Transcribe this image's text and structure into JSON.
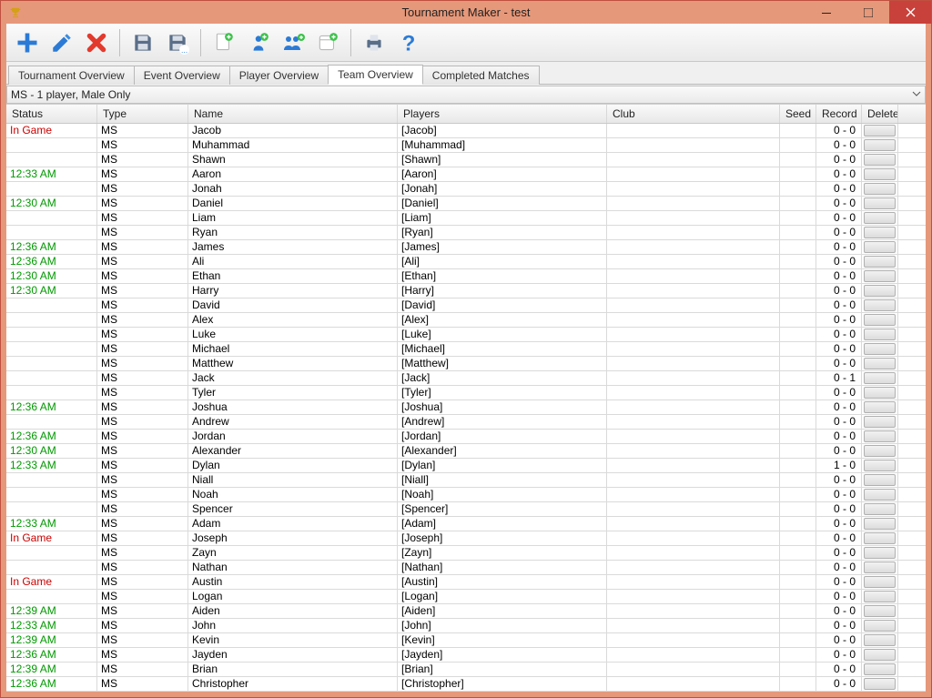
{
  "window": {
    "title": "Tournament Maker - test"
  },
  "tabs": [
    {
      "label": "Tournament Overview",
      "active": false
    },
    {
      "label": "Event Overview",
      "active": false
    },
    {
      "label": "Player Overview",
      "active": false
    },
    {
      "label": "Team Overview",
      "active": true
    },
    {
      "label": "Completed Matches",
      "active": false
    }
  ],
  "dropdown": {
    "label": "MS - 1 player, Male Only"
  },
  "columns": {
    "status": "Status",
    "type": "Type",
    "name": "Name",
    "players": "Players",
    "club": "Club",
    "seed": "Seed",
    "record": "Record",
    "delete": "Delete"
  },
  "rows": [
    {
      "status": "In Game",
      "statusKind": "ingame",
      "type": "MS",
      "name": "Jacob",
      "players": "[Jacob]",
      "club": "",
      "seed": "",
      "record": "0 - 0"
    },
    {
      "status": "",
      "statusKind": "",
      "type": "MS",
      "name": "Muhammad",
      "players": "[Muhammad]",
      "club": "",
      "seed": "",
      "record": "0 - 0"
    },
    {
      "status": "",
      "statusKind": "",
      "type": "MS",
      "name": "Shawn",
      "players": "[Shawn]",
      "club": "",
      "seed": "",
      "record": "0 - 0"
    },
    {
      "status": "12:33 AM",
      "statusKind": "time",
      "type": "MS",
      "name": "Aaron",
      "players": "[Aaron]",
      "club": "",
      "seed": "",
      "record": "0 - 0"
    },
    {
      "status": "",
      "statusKind": "",
      "type": "MS",
      "name": "Jonah",
      "players": "[Jonah]",
      "club": "",
      "seed": "",
      "record": "0 - 0"
    },
    {
      "status": "12:30 AM",
      "statusKind": "time",
      "type": "MS",
      "name": "Daniel",
      "players": "[Daniel]",
      "club": "",
      "seed": "",
      "record": "0 - 0"
    },
    {
      "status": "",
      "statusKind": "",
      "type": "MS",
      "name": "Liam",
      "players": "[Liam]",
      "club": "",
      "seed": "",
      "record": "0 - 0"
    },
    {
      "status": "",
      "statusKind": "",
      "type": "MS",
      "name": "Ryan",
      "players": "[Ryan]",
      "club": "",
      "seed": "",
      "record": "0 - 0"
    },
    {
      "status": "12:36 AM",
      "statusKind": "time",
      "type": "MS",
      "name": "James",
      "players": "[James]",
      "club": "",
      "seed": "",
      "record": "0 - 0"
    },
    {
      "status": "12:36 AM",
      "statusKind": "time",
      "type": "MS",
      "name": "Ali",
      "players": "[Ali]",
      "club": "",
      "seed": "",
      "record": "0 - 0"
    },
    {
      "status": "12:30 AM",
      "statusKind": "time",
      "type": "MS",
      "name": "Ethan",
      "players": "[Ethan]",
      "club": "",
      "seed": "",
      "record": "0 - 0"
    },
    {
      "status": "12:30 AM",
      "statusKind": "time",
      "type": "MS",
      "name": "Harry",
      "players": "[Harry]",
      "club": "",
      "seed": "",
      "record": "0 - 0"
    },
    {
      "status": "",
      "statusKind": "",
      "type": "MS",
      "name": "David",
      "players": "[David]",
      "club": "",
      "seed": "",
      "record": "0 - 0"
    },
    {
      "status": "",
      "statusKind": "",
      "type": "MS",
      "name": "Alex",
      "players": "[Alex]",
      "club": "",
      "seed": "",
      "record": "0 - 0"
    },
    {
      "status": "",
      "statusKind": "",
      "type": "MS",
      "name": "Luke",
      "players": "[Luke]",
      "club": "",
      "seed": "",
      "record": "0 - 0"
    },
    {
      "status": "",
      "statusKind": "",
      "type": "MS",
      "name": "Michael",
      "players": "[Michael]",
      "club": "",
      "seed": "",
      "record": "0 - 0"
    },
    {
      "status": "",
      "statusKind": "",
      "type": "MS",
      "name": "Matthew",
      "players": "[Matthew]",
      "club": "",
      "seed": "",
      "record": "0 - 0"
    },
    {
      "status": "",
      "statusKind": "",
      "type": "MS",
      "name": "Jack",
      "players": "[Jack]",
      "club": "",
      "seed": "",
      "record": "0 - 1"
    },
    {
      "status": "",
      "statusKind": "",
      "type": "MS",
      "name": "Tyler",
      "players": "[Tyler]",
      "club": "",
      "seed": "",
      "record": "0 - 0"
    },
    {
      "status": "12:36 AM",
      "statusKind": "time",
      "type": "MS",
      "name": "Joshua",
      "players": "[Joshua]",
      "club": "",
      "seed": "",
      "record": "0 - 0"
    },
    {
      "status": "",
      "statusKind": "",
      "type": "MS",
      "name": "Andrew",
      "players": "[Andrew]",
      "club": "",
      "seed": "",
      "record": "0 - 0"
    },
    {
      "status": "12:36 AM",
      "statusKind": "time",
      "type": "MS",
      "name": "Jordan",
      "players": "[Jordan]",
      "club": "",
      "seed": "",
      "record": "0 - 0"
    },
    {
      "status": "12:30 AM",
      "statusKind": "time",
      "type": "MS",
      "name": "Alexander",
      "players": "[Alexander]",
      "club": "",
      "seed": "",
      "record": "0 - 0"
    },
    {
      "status": "12:33 AM",
      "statusKind": "time",
      "type": "MS",
      "name": "Dylan",
      "players": "[Dylan]",
      "club": "",
      "seed": "",
      "record": "1 - 0"
    },
    {
      "status": "",
      "statusKind": "",
      "type": "MS",
      "name": "Niall",
      "players": "[Niall]",
      "club": "",
      "seed": "",
      "record": "0 - 0"
    },
    {
      "status": "",
      "statusKind": "",
      "type": "MS",
      "name": "Noah",
      "players": "[Noah]",
      "club": "",
      "seed": "",
      "record": "0 - 0"
    },
    {
      "status": "",
      "statusKind": "",
      "type": "MS",
      "name": "Spencer",
      "players": "[Spencer]",
      "club": "",
      "seed": "",
      "record": "0 - 0"
    },
    {
      "status": "12:33 AM",
      "statusKind": "time",
      "type": "MS",
      "name": "Adam",
      "players": "[Adam]",
      "club": "",
      "seed": "",
      "record": "0 - 0"
    },
    {
      "status": "In Game",
      "statusKind": "ingame",
      "type": "MS",
      "name": "Joseph",
      "players": "[Joseph]",
      "club": "",
      "seed": "",
      "record": "0 - 0"
    },
    {
      "status": "",
      "statusKind": "",
      "type": "MS",
      "name": "Zayn",
      "players": "[Zayn]",
      "club": "",
      "seed": "",
      "record": "0 - 0"
    },
    {
      "status": "",
      "statusKind": "",
      "type": "MS",
      "name": "Nathan",
      "players": "[Nathan]",
      "club": "",
      "seed": "",
      "record": "0 - 0"
    },
    {
      "status": "In Game",
      "statusKind": "ingame",
      "type": "MS",
      "name": "Austin",
      "players": "[Austin]",
      "club": "",
      "seed": "",
      "record": "0 - 0"
    },
    {
      "status": "",
      "statusKind": "",
      "type": "MS",
      "name": "Logan",
      "players": "[Logan]",
      "club": "",
      "seed": "",
      "record": "0 - 0"
    },
    {
      "status": "12:39 AM",
      "statusKind": "time",
      "type": "MS",
      "name": "Aiden",
      "players": "[Aiden]",
      "club": "",
      "seed": "",
      "record": "0 - 0"
    },
    {
      "status": "12:33 AM",
      "statusKind": "time",
      "type": "MS",
      "name": "John",
      "players": "[John]",
      "club": "",
      "seed": "",
      "record": "0 - 0"
    },
    {
      "status": "12:39 AM",
      "statusKind": "time",
      "type": "MS",
      "name": "Kevin",
      "players": "[Kevin]",
      "club": "",
      "seed": "",
      "record": "0 - 0"
    },
    {
      "status": "12:36 AM",
      "statusKind": "time",
      "type": "MS",
      "name": "Jayden",
      "players": "[Jayden]",
      "club": "",
      "seed": "",
      "record": "0 - 0"
    },
    {
      "status": "12:39 AM",
      "statusKind": "time",
      "type": "MS",
      "name": "Brian",
      "players": "[Brian]",
      "club": "",
      "seed": "",
      "record": "0 - 0"
    },
    {
      "status": "12:36 AM",
      "statusKind": "time",
      "type": "MS",
      "name": "Christopher",
      "players": "[Christopher]",
      "club": "",
      "seed": "",
      "record": "0 - 0"
    }
  ]
}
